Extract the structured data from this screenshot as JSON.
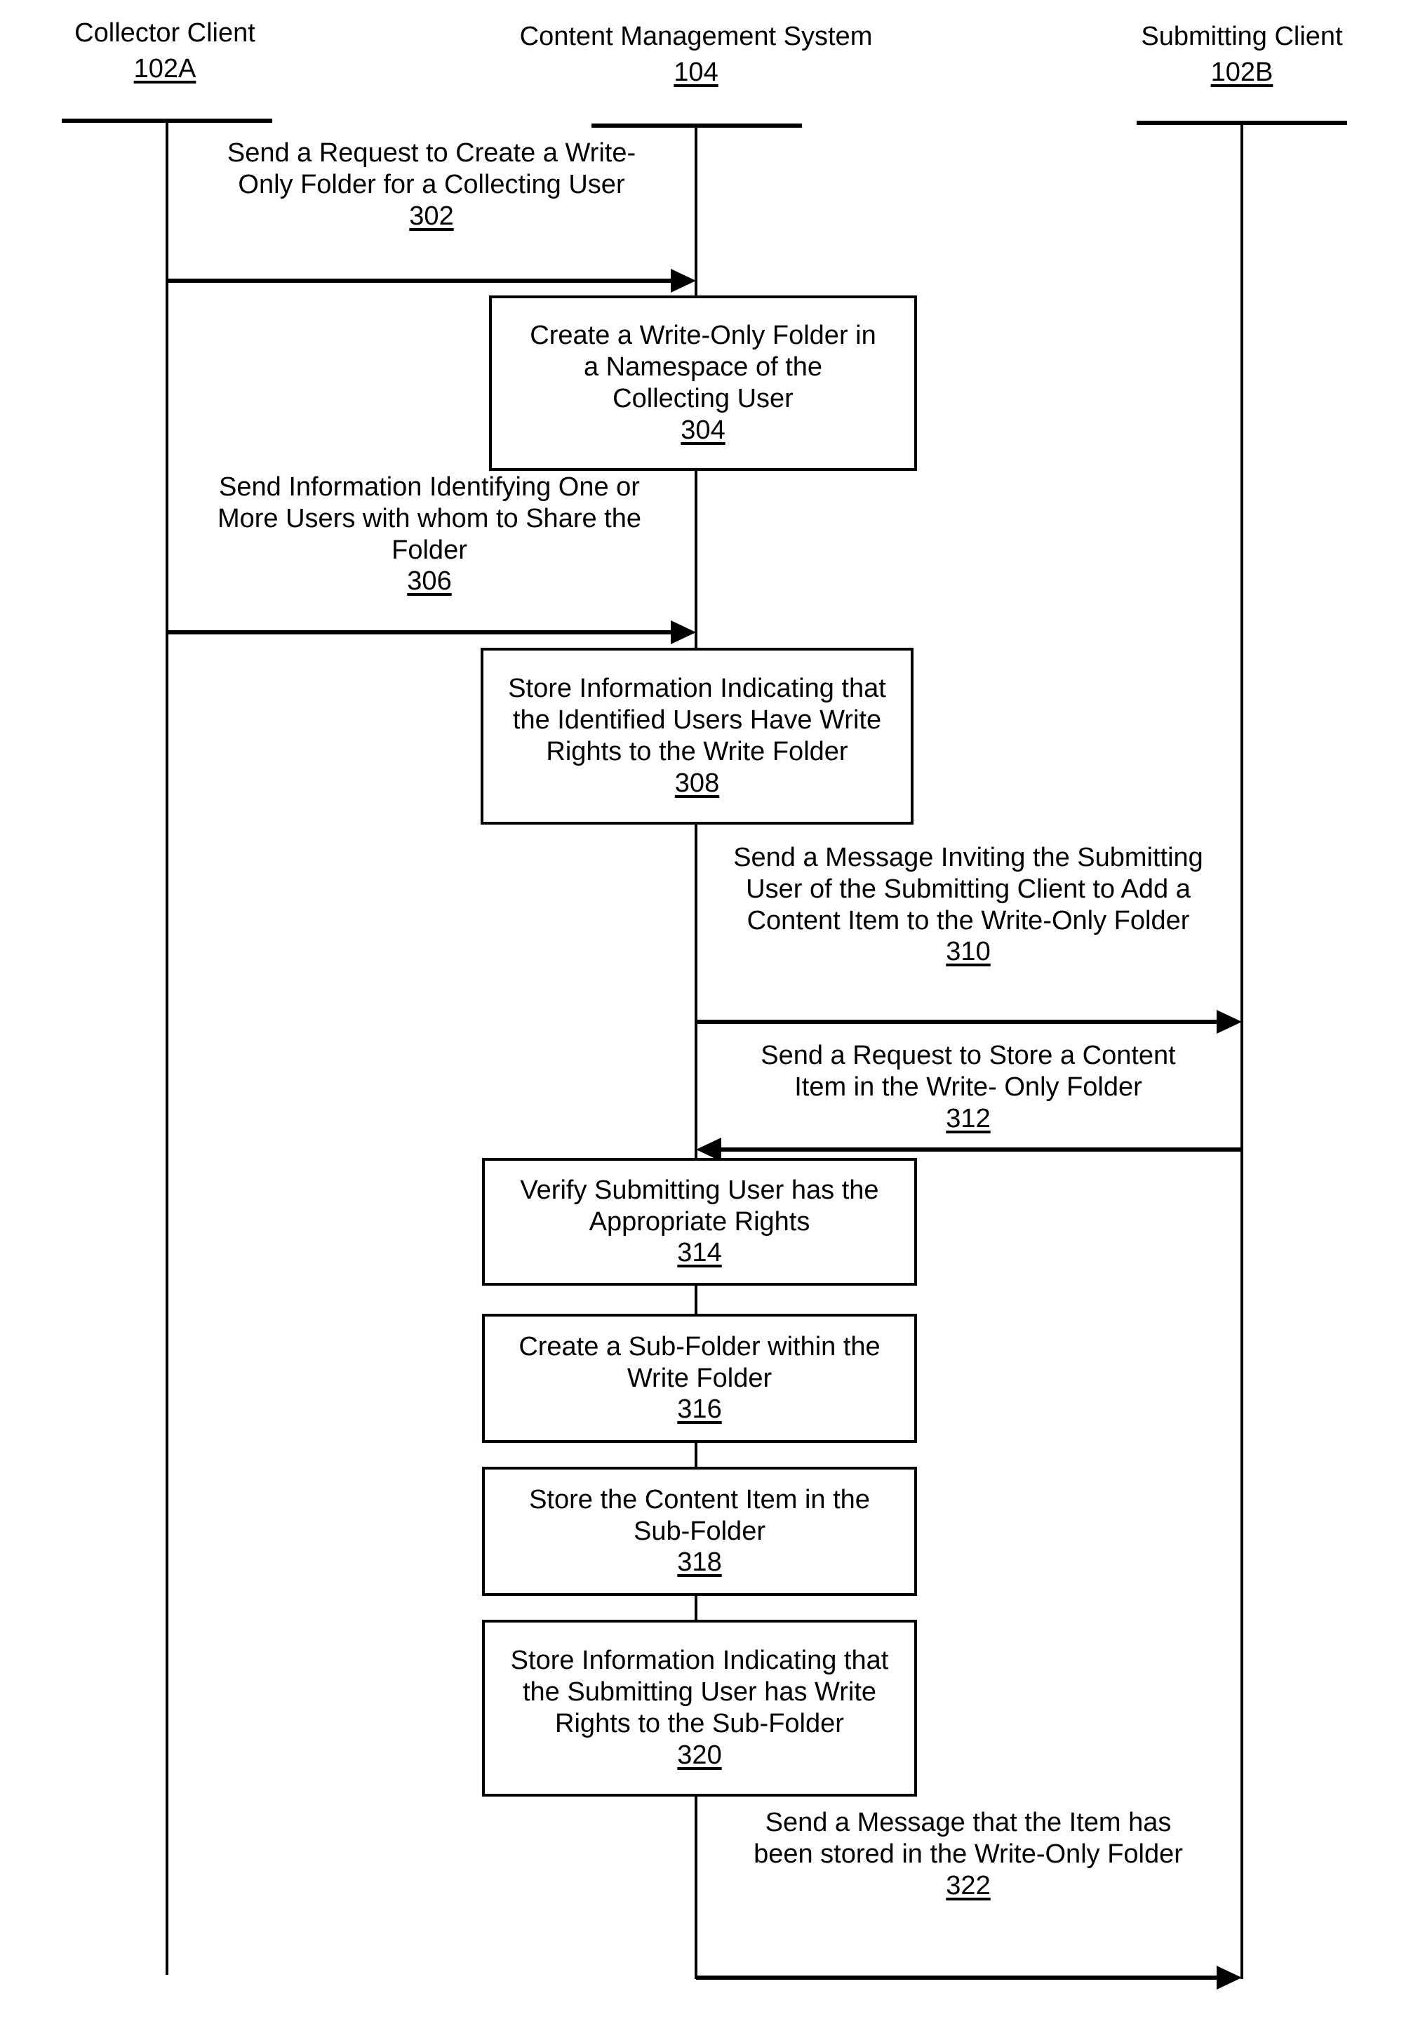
{
  "figure": {
    "type": "sequence-diagram",
    "actors": [
      {
        "title": "Collector Client",
        "ref": "102A"
      },
      {
        "title": "Content Management System",
        "ref": "104"
      },
      {
        "title": "Submitting Client",
        "ref": "102B"
      }
    ],
    "messages": [
      {
        "ref": "302",
        "text": "Send a Request to Create a Write-\nOnly Folder for a Collecting User",
        "from": "Collector Client",
        "to": "Content Management System",
        "direction": "right"
      },
      {
        "ref": "306",
        "text": "Send Information Identifying One or\nMore Users with whom to Share the\nFolder",
        "from": "Collector Client",
        "to": "Content Management System",
        "direction": "right"
      },
      {
        "ref": "310",
        "text": "Send a Message Inviting the Submitting\nUser of the Submitting Client to Add a\nContent Item to the Write-Only Folder",
        "from": "Content Management System",
        "to": "Submitting Client",
        "direction": "right"
      },
      {
        "ref": "312",
        "text": "Send a Request to Store a Content\nItem in the Write- Only Folder",
        "from": "Submitting Client",
        "to": "Content Management System",
        "direction": "left"
      },
      {
        "ref": "322",
        "text": "Send a Message that the Item has\nbeen stored in the Write-Only Folder",
        "from": "Content Management System",
        "to": "Submitting Client",
        "direction": "right"
      }
    ],
    "process_boxes": [
      {
        "ref": "304",
        "text": "Create a Write-Only Folder in\na Namespace of the\nCollecting User",
        "lane": "Content Management System"
      },
      {
        "ref": "308",
        "text": "Store Information Indicating that\nthe Identified Users Have Write\nRights to the Write Folder",
        "lane": "Content Management System"
      },
      {
        "ref": "314",
        "text": "Verify Submitting User has the\nAppropriate Rights",
        "lane": "Content Management System"
      },
      {
        "ref": "316",
        "text": "Create a Sub-Folder within the\nWrite Folder",
        "lane": "Content Management System"
      },
      {
        "ref": "318",
        "text": "Store the Content Item in the\nSub-Folder",
        "lane": "Content Management System"
      },
      {
        "ref": "320",
        "text": "Store Information Indicating that\nthe Submitting User has Write\nRights to the Sub-Folder",
        "lane": "Content Management System"
      }
    ],
    "colors": {
      "ink": "#000000",
      "paper": "#ffffff"
    }
  }
}
